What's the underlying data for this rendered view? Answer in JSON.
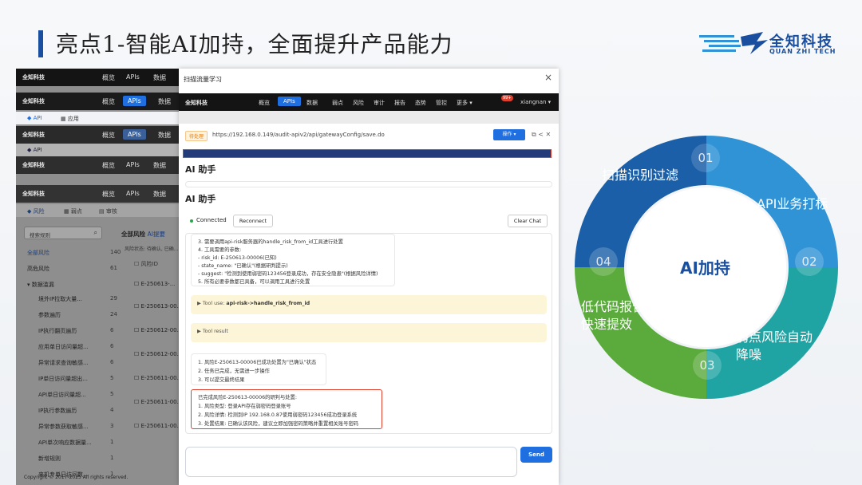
{
  "slide": {
    "title": "亮点1-智能AI加持，全面提升产品能力",
    "brand_cn": "全知科技",
    "brand_en": "QUAN ZHI TECH",
    "copyright": "Copyright © 2017-2025 All rights reserved."
  },
  "background_app": {
    "logo": "全知科技",
    "nav": [
      "概览",
      "APIs",
      "数据"
    ],
    "subtabs": [
      "API",
      "应用"
    ],
    "subtabs_full": [
      "风险",
      "弱点",
      "审核"
    ],
    "search_placeholder": "搜索规则",
    "section_title": "全部风险",
    "section_sub": "AI提要",
    "filter_hint": "风险状态: 待确认, 已确...",
    "col_header": "风险ID",
    "sidebar": [
      {
        "label": "全部风险",
        "count": "140"
      },
      {
        "label": "高危风险",
        "count": "61"
      },
      {
        "label": "数据滥漏",
        "count": ""
      },
      {
        "label": "境外IP拉取大量...",
        "count": "29"
      },
      {
        "label": "参数遍历",
        "count": "24"
      },
      {
        "label": "IP执行翻页遍历",
        "count": "6"
      },
      {
        "label": "应用单日访问量超...",
        "count": "6"
      },
      {
        "label": "异常请求查询敏感...",
        "count": "6"
      },
      {
        "label": "IP单日访问量超出...",
        "count": "5"
      },
      {
        "label": "API单日访问量超...",
        "count": "5"
      },
      {
        "label": "IP执行参数遍历",
        "count": "4"
      },
      {
        "label": "异常参数获取敏感...",
        "count": "3"
      },
      {
        "label": "API单次响应数据量...",
        "count": "1"
      },
      {
        "label": "新增规则",
        "count": "1"
      },
      {
        "label": "来机专单日访问数...",
        "count": "1"
      }
    ],
    "risk_ids": [
      "E-250613-...",
      "E-250613-00...",
      "E-250612-00...",
      "E-250612-00...",
      "E-250611-00...",
      "E-250611-00...",
      "E-250611-00..."
    ]
  },
  "modal": {
    "title": "扫描流量学习",
    "close": "×",
    "nav": {
      "logo": "全知科技",
      "items": [
        "概览",
        "APIs",
        "数据",
        "弱点",
        "风险",
        "审计",
        "报告",
        "态势",
        "管控",
        "更多 ▾"
      ],
      "user": "xiangnan ▾",
      "badge": "99+"
    },
    "request": {
      "tag": "待处理",
      "url": "https://192.168.0.149/audit-apiv2/api/gatewayConfig/save.do",
      "action_button": "操作 ▾",
      "icons": "⧉  <  ✕"
    },
    "ai_title_1": "AI 助手",
    "ai_title_2": "AI 助手",
    "status": "Connected",
    "reconnect": "Reconnect",
    "clear_chat": "Clear Chat",
    "message_lines": [
      "3. 需要调用api-risk服务器的handle_risk_from_id工具进行处置",
      "4. 工具需要的参数:",
      "- risk_id: E-250613-00006(已知)",
      "- state_name: \"已确认\"(根据研判提示)",
      "- suggest: \"检测到使用弱密码123456登录成功，存在安全隐患\"(根据风险详情)",
      "5. 所有必要参数都已具备，可以调用工具进行处置"
    ],
    "tool_use_prefix": "▶  Tool use: ",
    "tool_use_name": "api-risk->handle_risk_from_id",
    "tool_result": "▶  Tool result",
    "result_lines": [
      "1. 风险E-250613-00006已成功处置为\"已确认\"状态",
      "2. 任务已完成，无需进一步操作",
      "3. 可以提交最终结果"
    ],
    "final_lines": [
      "已完成风险E-250613-00006的研判与处置:",
      "1. 风险类型: 登录API存在弱密码登录账号",
      "2. 风险详情: 检测到IP 192.168.0.87使用弱密码123456成功登录系统",
      "3. 处置结果: 已确认该风险，建议立即加强密码策略并重置相关账号密码"
    ],
    "input_placeholder": "",
    "send": "Send"
  },
  "diagram": {
    "center": "AI加持",
    "segments": [
      {
        "num": "01",
        "label": "扫描识别过滤",
        "color": "#1a5fa8"
      },
      {
        "num": "02",
        "label": "API业务打标",
        "color": "#2f93d6"
      },
      {
        "num": "03",
        "label_lines": [
          "弱点风险自动",
          "降噪"
        ],
        "color": "#1fa3a3"
      },
      {
        "num": "04",
        "label_lines": [
          "低代码报告",
          "快速提效"
        ],
        "color": "#5aaa3c"
      }
    ]
  }
}
